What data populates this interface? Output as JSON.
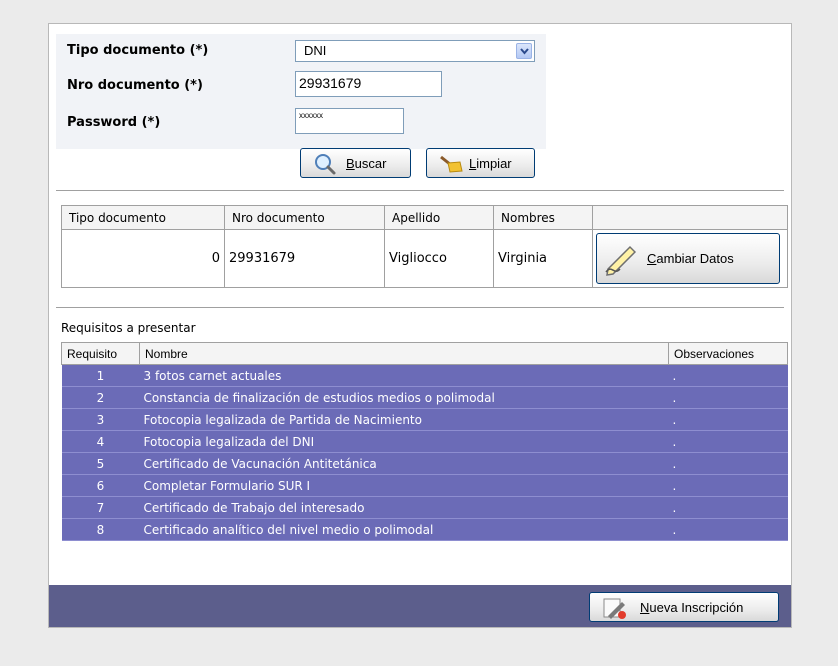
{
  "form": {
    "tipo_label": "Tipo documento (*)",
    "tipo_value": "DNI",
    "nro_label": "Nro documento (*)",
    "nro_value": "29931679",
    "password_label": "Password (*)",
    "password_value": "xxxxxx",
    "buscar_label_u": "B",
    "buscar_label_rest": "uscar",
    "limpiar_label_u": "L",
    "limpiar_label_rest": "impiar"
  },
  "results": {
    "headers": [
      "Tipo documento",
      "Nro documento",
      "Apellido",
      "Nombres",
      ""
    ],
    "row": {
      "tipo": "0",
      "nro": "29931679",
      "apellido": "Vigliocco",
      "nombres": "Virginia"
    },
    "cambiar_u": "C",
    "cambiar_rest": "ambiar Datos"
  },
  "requisitos": {
    "title": "Requisitos a presentar",
    "headers": [
      "Requisito",
      "Nombre",
      "Observaciones"
    ],
    "rows": [
      {
        "num": "1",
        "nombre": "3 fotos carnet actuales",
        "obs": "."
      },
      {
        "num": "2",
        "nombre": "Constancia de finalización de estudios medios o polimodal",
        "obs": "."
      },
      {
        "num": "3",
        "nombre": "Fotocopia legalizada de Partida de Nacimiento",
        "obs": "."
      },
      {
        "num": "4",
        "nombre": "Fotocopia legalizada del DNI",
        "obs": "."
      },
      {
        "num": "5",
        "nombre": "Certificado de Vacunación Antitetánica",
        "obs": "."
      },
      {
        "num": "6",
        "nombre": "Completar Formulario SUR I",
        "obs": "."
      },
      {
        "num": "7",
        "nombre": "Certificado de Trabajo del interesado",
        "obs": "."
      },
      {
        "num": "8",
        "nombre": "Certificado analítico del nivel medio o polimodal",
        "obs": "."
      }
    ]
  },
  "footer": {
    "nueva_u": "N",
    "nueva_rest": "ueva Inscripción"
  },
  "colors": {
    "row_bg": "#6b6bb7",
    "footer_bg": "#5c5e8c",
    "button_border": "#003c74"
  }
}
